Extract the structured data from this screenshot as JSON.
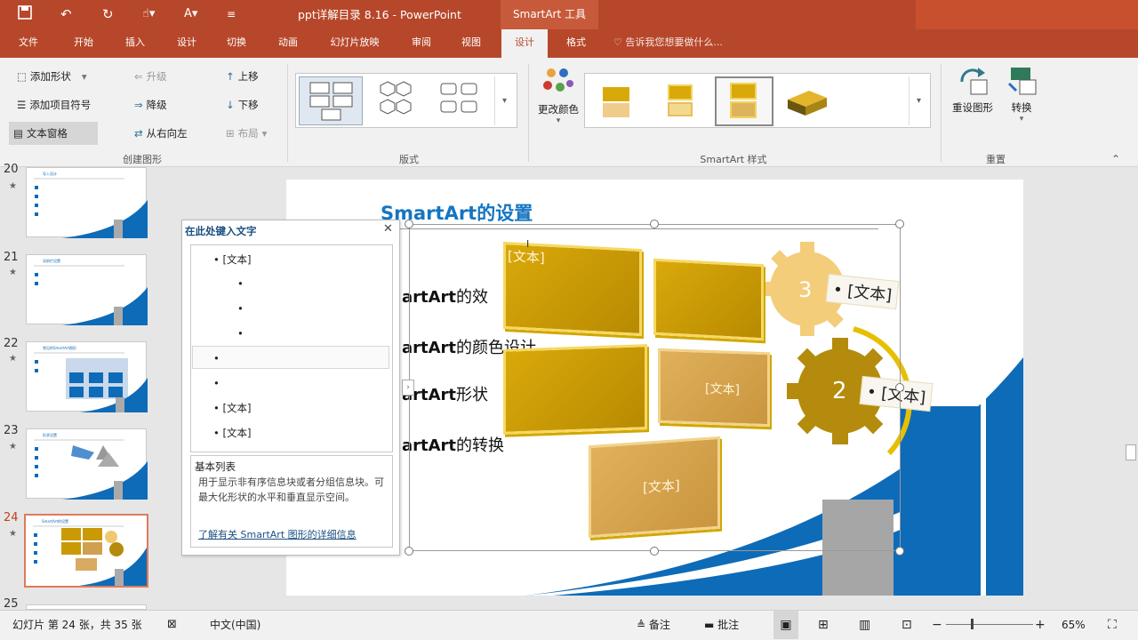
{
  "window": {
    "title": "ppt详解目录 8.16 - PowerPoint",
    "context_tab": "SmartArt 工具"
  },
  "tabs": [
    {
      "label": "文件"
    },
    {
      "label": "开始"
    },
    {
      "label": "插入"
    },
    {
      "label": "设计"
    },
    {
      "label": "切换"
    },
    {
      "label": "动画"
    },
    {
      "label": "幻灯片放映"
    },
    {
      "label": "审阅"
    },
    {
      "label": "视图"
    },
    {
      "label": "设计"
    },
    {
      "label": "格式"
    }
  ],
  "tell_me": "告诉我您想要做什么...",
  "ribbon": {
    "create": {
      "add_shape": "添加形状",
      "add_bullet": "添加项目符号",
      "text_pane": "文本窗格",
      "promote": "升级",
      "demote": "降级",
      "rtl": "从右向左",
      "move_up": "上移",
      "move_down": "下移",
      "layout": "布局",
      "label": "创建图形"
    },
    "layouts_label": "版式",
    "change_colors": "更改颜色",
    "styles_label": "SmartArt 样式",
    "reset_graphic": "重设图形",
    "convert": "转换",
    "reset_label": "重置"
  },
  "thumbnails": [
    {
      "num": "20",
      "title": "导入设计"
    },
    {
      "num": "21",
      "title": "导航栏设置"
    },
    {
      "num": "22",
      "title": "常见的SmartArt图形"
    },
    {
      "num": "23",
      "title": "形状设置"
    },
    {
      "num": "24",
      "title": "SmartArt的设置"
    },
    {
      "num": "25",
      "title": ""
    }
  ],
  "textpane": {
    "title": "在此处键入文字",
    "items": [
      "[文本]",
      "",
      "",
      "",
      "",
      "",
      "[文本]",
      "[文本]"
    ],
    "info_title": "基本列表",
    "info_desc": "用于显示非有序信息块或者分组信息块。可最大化形状的水平和垂直显示空间。",
    "info_link": "了解有关 SmartArt 图形的详细信息"
  },
  "slide": {
    "title": "SmartArt的设置",
    "bullets": [
      {
        "pre": "artArt",
        "post": "的效"
      },
      {
        "pre": "artArt",
        "post": "的颜色设计"
      },
      {
        "pre": "artArt",
        "post": "形状"
      },
      {
        "pre": "artArt",
        "post": "的转换"
      }
    ],
    "tiles": [
      "[文本]",
      "",
      "",
      "[文本]",
      "[文本]"
    ],
    "gears": [
      {
        "num": "3",
        "label": "[文本]"
      },
      {
        "num": "2",
        "label": "[文本]"
      }
    ]
  },
  "status": {
    "slide_info": "幻灯片 第 24 张，共 35 张",
    "language": "中文(中国)",
    "notes": "备注",
    "comments": "批注",
    "zoom": "65%"
  },
  "colors": {
    "accent": "#b7472a",
    "gold": "#d9a90a",
    "blue": "#0e6bb8"
  }
}
